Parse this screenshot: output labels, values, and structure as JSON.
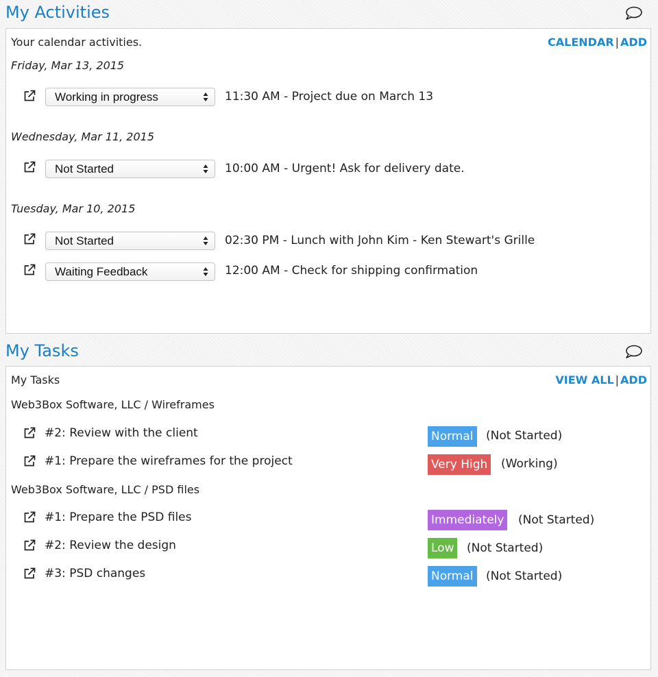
{
  "activities": {
    "title": "My Activities",
    "icon": "comment-icon",
    "description": "Your calendar activities.",
    "links": {
      "calendar": "CALENDAR",
      "separator": "|",
      "add": "ADD"
    },
    "days": [
      {
        "date": "Friday, Mar 13, 2015",
        "items": [
          {
            "status": "Working in progress",
            "text": "11:30 AM - Project due on March 13"
          }
        ]
      },
      {
        "date": "Wednesday, Mar 11, 2015",
        "items": [
          {
            "status": "Not Started",
            "text": "10:00 AM - Urgent! Ask for delivery date."
          }
        ]
      },
      {
        "date": "Tuesday, Mar 10, 2015",
        "items": [
          {
            "status": "Not Started",
            "text": "02:30 PM - Lunch with John Kim - Ken Stewart's Grille"
          },
          {
            "status": "Waiting Feedback",
            "text": "12:00 AM - Check for shipping confirmation"
          }
        ]
      }
    ]
  },
  "tasks": {
    "title": "My Tasks",
    "icon": "comment-icon",
    "description": "My Tasks",
    "links": {
      "view_all": "VIEW ALL",
      "separator": "|",
      "add": "ADD"
    },
    "groups": [
      {
        "name": "Web3Box Software, LLC / Wireframes",
        "items": [
          {
            "label": "#2: Review with the client",
            "priority": "Normal",
            "status": "(Not Started)"
          },
          {
            "label": "#1: Prepare the wireframes for the project",
            "priority": "Very High",
            "status": "(Working)"
          }
        ]
      },
      {
        "name": "Web3Box Software, LLC / PSD files",
        "items": [
          {
            "label": "#1: Prepare the PSD files",
            "priority": "Immediately",
            "status": "(Not Started)"
          },
          {
            "label": "#2: Review the design",
            "priority": "Low",
            "status": "(Not Started)"
          },
          {
            "label": "#3: PSD changes",
            "priority": "Normal",
            "status": "(Not Started)"
          }
        ]
      }
    ]
  },
  "colors": {
    "title": "#1a7fc4",
    "link": "#1a8ad2",
    "priority_normal": "#4aa3e8",
    "priority_very_high": "#e05a5a",
    "priority_immediately": "#b266e0",
    "priority_low": "#66bb44"
  }
}
